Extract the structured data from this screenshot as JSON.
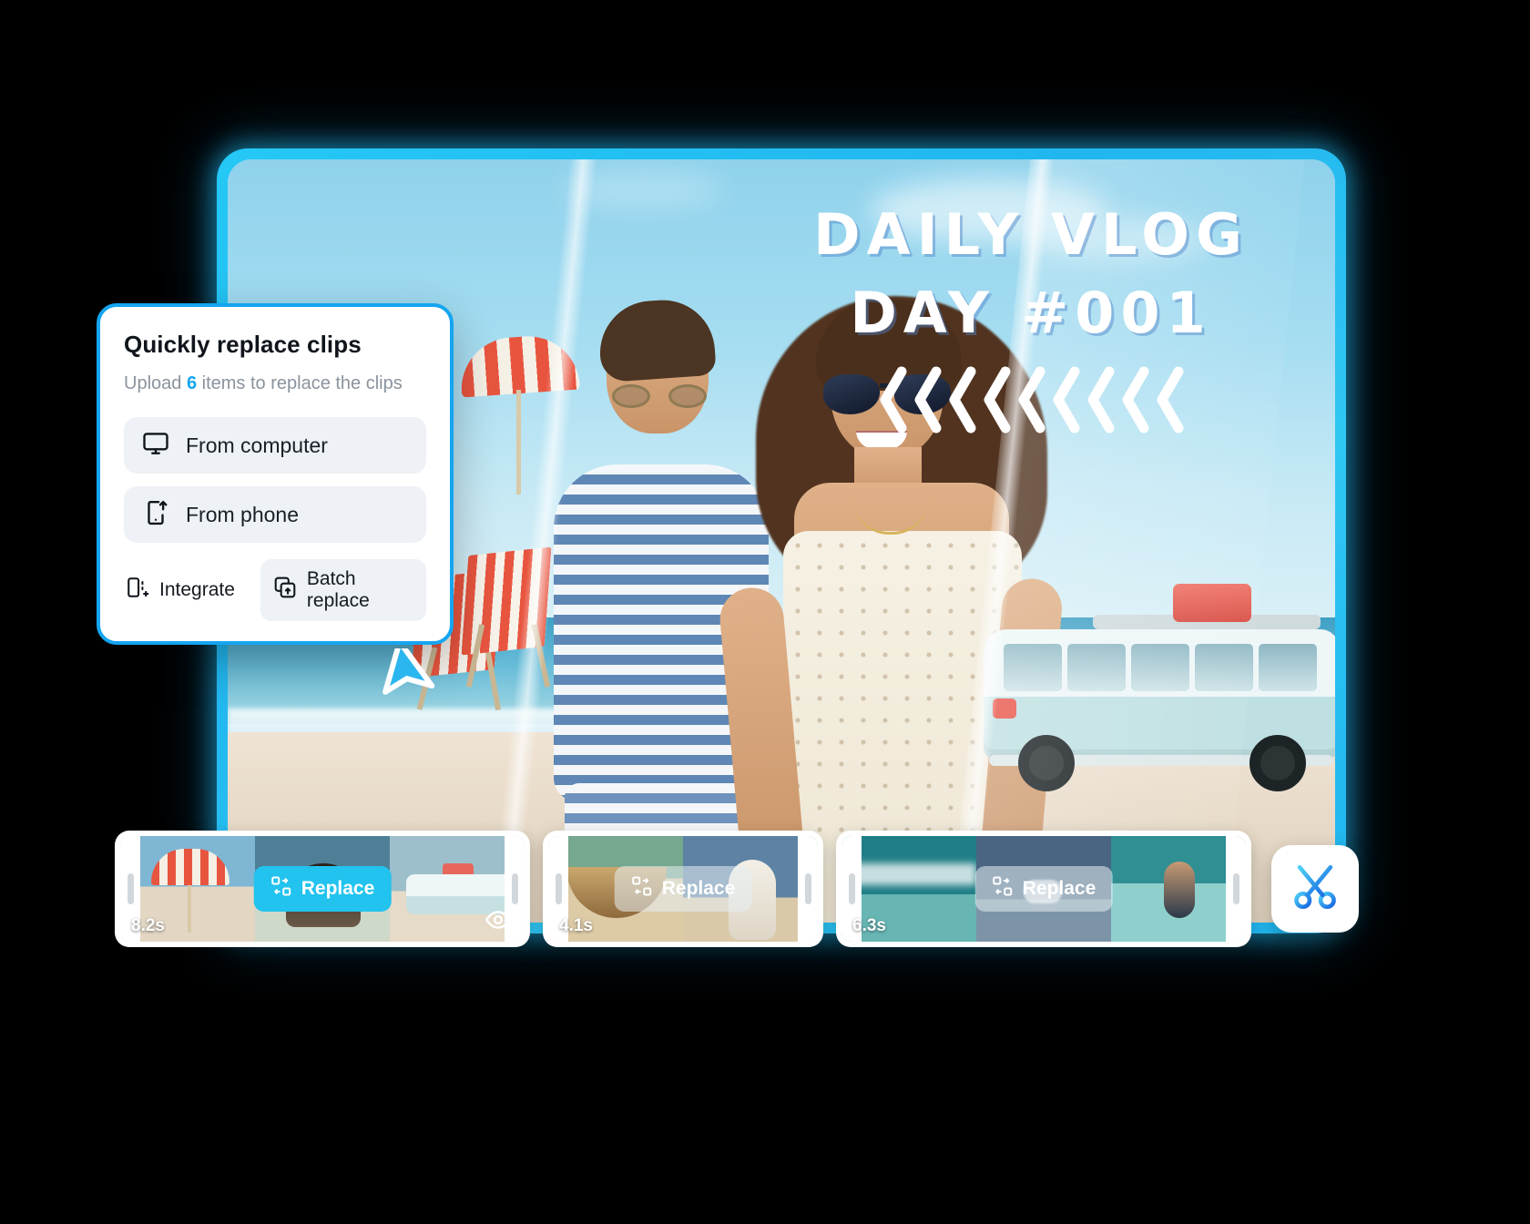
{
  "video": {
    "title_line1": "DAILY VLOG",
    "title_line2": "DAY #001",
    "chevron_count": 9,
    "chevron_icon": "chevron-left-icon"
  },
  "card": {
    "heading": "Quickly replace clips",
    "subtitle_prefix": "Upload",
    "subtitle_count": "6",
    "subtitle_suffix": "items to replace the clips",
    "options": [
      {
        "label": "From computer",
        "icon": "monitor-icon"
      },
      {
        "label": "From phone",
        "icon": "phone-upload-icon"
      }
    ],
    "actions": [
      {
        "label": "Integrate",
        "icon": "integrate-icon",
        "style": "ghost"
      },
      {
        "label": "Batch replace",
        "icon": "batch-replace-icon",
        "style": "filled"
      }
    ],
    "accent_color": "#15a5f0"
  },
  "cursor": {
    "icon": "pointer-arrow-icon",
    "color": "#2bb6ef"
  },
  "timeline": {
    "clips": [
      {
        "duration": "8.2s",
        "replace_label": "Replace",
        "replace_style": "solid",
        "has_eye": true,
        "eye_icon": "eye-icon",
        "frames": [
          "fr-umbrella",
          "fr-couple",
          "fr-van"
        ]
      },
      {
        "duration": "4.1s",
        "replace_label": "Replace",
        "replace_style": "ghost",
        "has_eye": false,
        "eye_icon": "eye-icon",
        "frames": [
          "fr-hammock",
          "fr-dress"
        ]
      },
      {
        "duration": "6.3s",
        "replace_label": "Replace",
        "replace_style": "ghost",
        "has_eye": false,
        "eye_icon": "eye-icon",
        "frames": [
          "fr-wave-top",
          "fr-surf-blue",
          "fr-surfer"
        ]
      }
    ],
    "cut_button": {
      "icon": "scissors-icon",
      "color": "#2196f3"
    }
  },
  "colors": {
    "accent": "#15a5f0",
    "badge": "#22c3ee",
    "frame_glow": "#22bef0"
  }
}
